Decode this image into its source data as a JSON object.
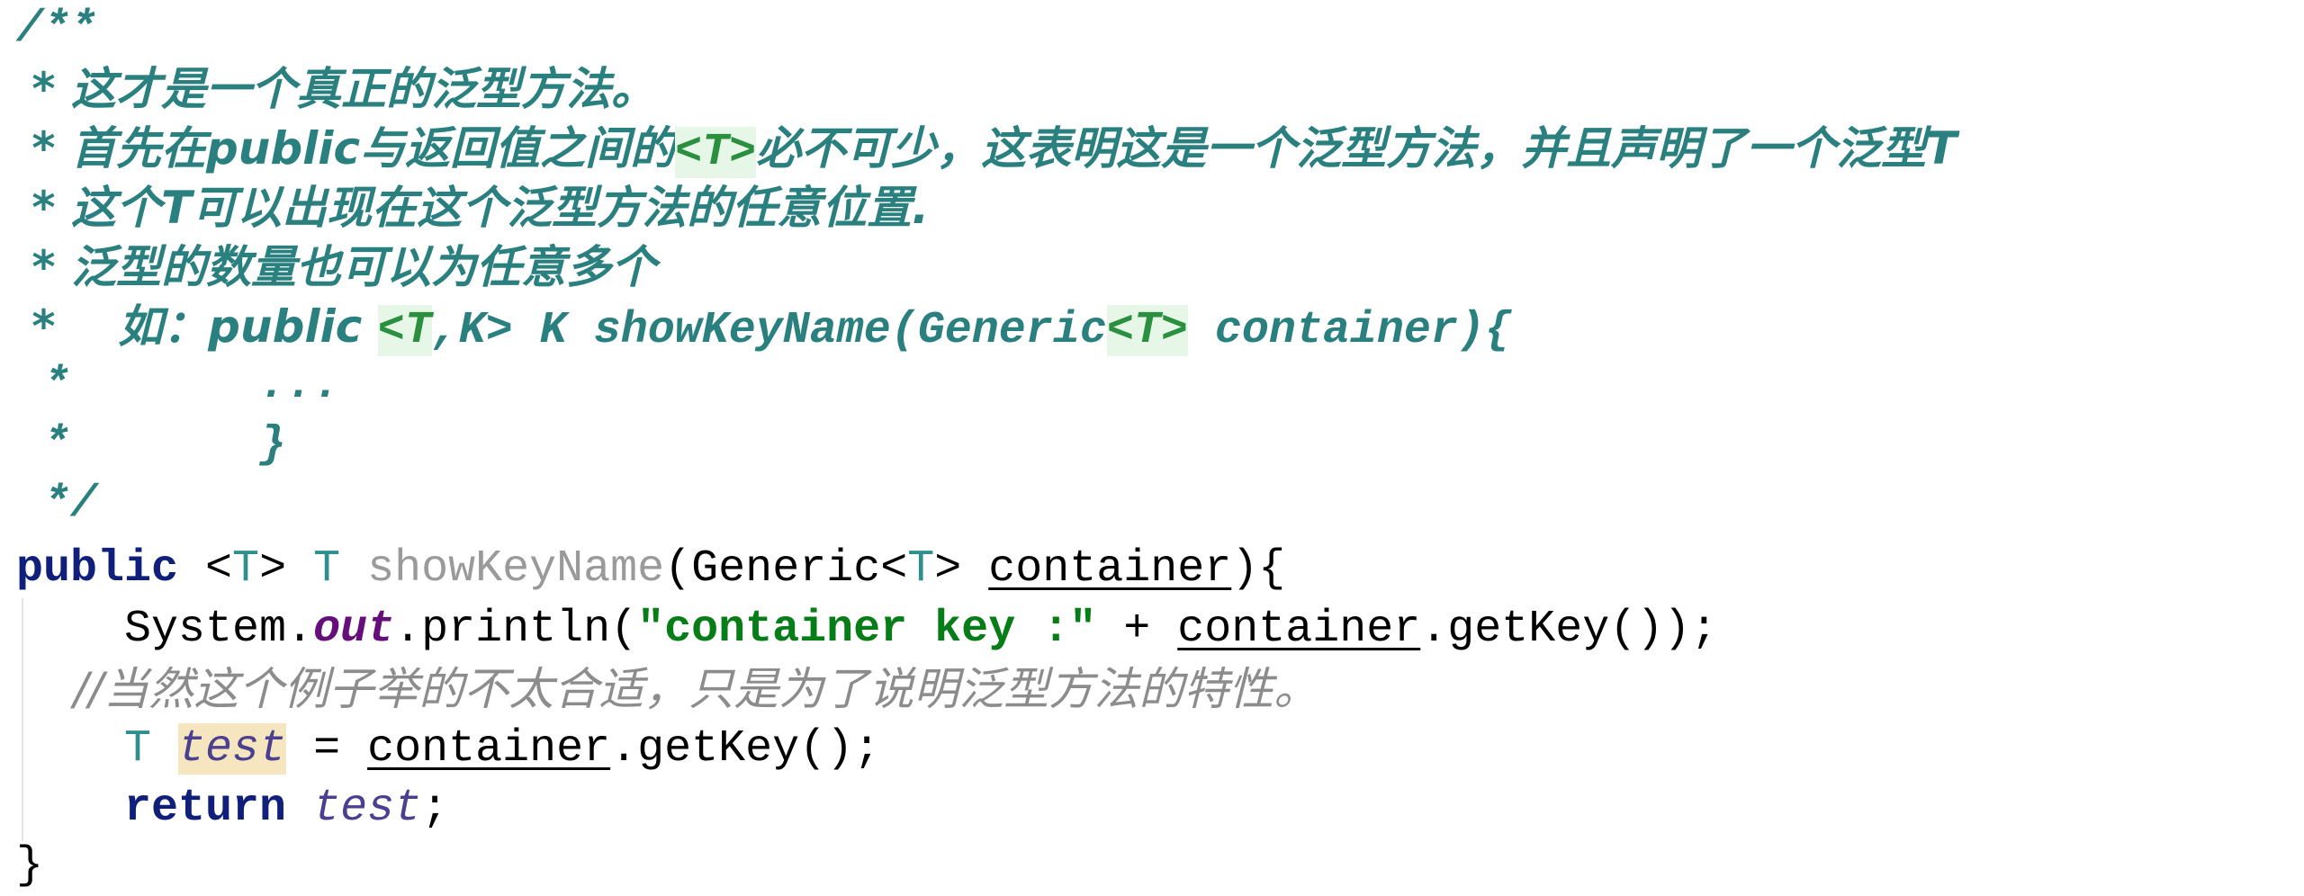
{
  "editor": {
    "doc_comment": {
      "open": "/**",
      "line1": " * 这才是一个真正的泛型方法。",
      "line2_a": " * 首先在public与返回值之间的",
      "line2_tag": "<T>",
      "line2_b": "必不可少，这表明这是一个泛型方法，并且声明了一个泛型T",
      "line3": " * 这个T可以出现在这个泛型方法的任意位置.",
      "line4": " * 泛型的数量也可以为任意多个",
      "line5_a": " *    如：public ",
      "line5_tag1": "<T",
      "line5_tag1b": ",K>",
      "line5_b": " K showKeyName(Generic",
      "line5_tag2": "<T>",
      "line5_c": " container){",
      "line6": " *       ...",
      "line7": " *       }",
      "close": " */"
    },
    "code": {
      "sig_public": "public",
      "sig_lt": " <",
      "sig_T": "T",
      "sig_gt": "> ",
      "sig_ret": "T",
      "sig_space": " ",
      "sig_name": "showKeyName",
      "sig_paren": "(Generic<",
      "sig_T2": "T",
      "sig_gt2": "> ",
      "sig_param": "container",
      "sig_end": "){",
      "l2_system": "    System.",
      "l2_out": "out",
      "l2_println": ".println(",
      "l2_str": "\"container key :\"",
      "l2_plus": " + ",
      "l2_container": "container",
      "l2_end": ".getKey());",
      "l3_comment": "    //当然这个例子举的不太合适，只是为了说明泛型方法的特性。",
      "l4_T": "    T",
      "l4_sp": " ",
      "l4_test": "test",
      "l4_eq": " = ",
      "l4_container": "container",
      "l4_end": ".getKey();",
      "l5_return": "    return",
      "l5_sp": " ",
      "l5_test": "test",
      "l5_end": ";",
      "close": "}"
    }
  }
}
